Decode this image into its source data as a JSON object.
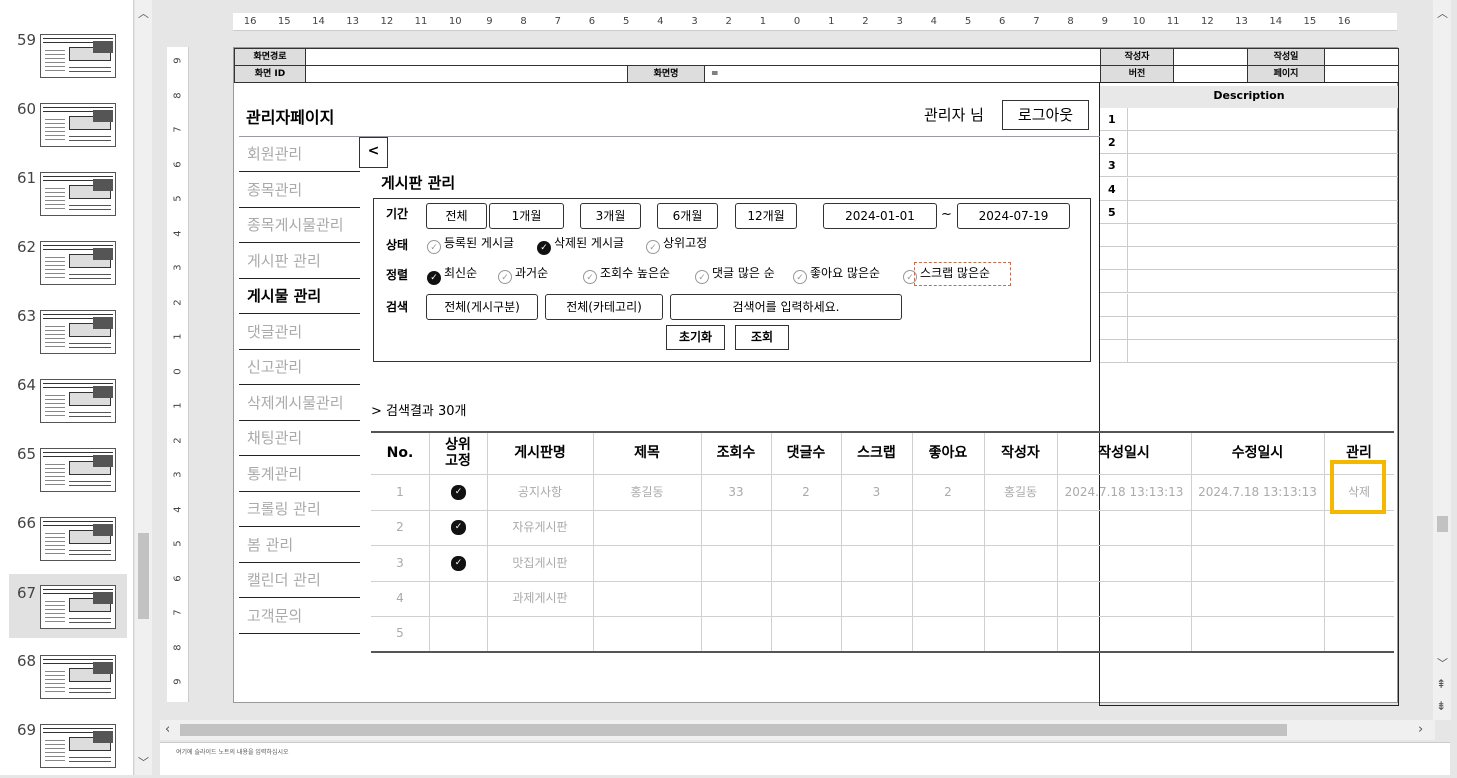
{
  "slides": [
    {
      "num": "59"
    },
    {
      "num": "60"
    },
    {
      "num": "61"
    },
    {
      "num": "62"
    },
    {
      "num": "63"
    },
    {
      "num": "64"
    },
    {
      "num": "65"
    },
    {
      "num": "66"
    },
    {
      "num": "67"
    },
    {
      "num": "68"
    },
    {
      "num": "69"
    }
  ],
  "selected_slide": "67",
  "ruler_h": [
    "16",
    "15",
    "14",
    "13",
    "12",
    "11",
    "10",
    "9",
    "8",
    "7",
    "6",
    "5",
    "4",
    "3",
    "2",
    "1",
    "0",
    "1",
    "2",
    "3",
    "4",
    "5",
    "6",
    "7",
    "8",
    "9",
    "10",
    "11",
    "12",
    "13",
    "14",
    "15",
    "16"
  ],
  "ruler_v": [
    "9",
    "8",
    "7",
    "6",
    "5",
    "4",
    "3",
    "2",
    "1",
    "0",
    "1",
    "2",
    "3",
    "4",
    "5",
    "6",
    "7",
    "8",
    "9"
  ],
  "header": {
    "path_label": "화면경로",
    "id_label": "화면 ID",
    "name_label": "화면명",
    "name_value": "=",
    "author_label": "작성자",
    "date_label": "작성일",
    "version_label": "버전",
    "page_label": "페이지",
    "description_label": "Description",
    "desc_rows": [
      "1",
      "2",
      "3",
      "4",
      "5",
      "",
      "",
      "",
      "",
      "",
      ""
    ]
  },
  "app": {
    "title": "관리자페이지",
    "user_text": "관리자 님",
    "logout": "로그아웃",
    "collapse": "<"
  },
  "sidebar": {
    "items": [
      {
        "label": "회원관리"
      },
      {
        "label": "종목관리"
      },
      {
        "label": "종목게시물관리"
      },
      {
        "label": "게시판 관리"
      },
      {
        "label": "게시물 관리"
      },
      {
        "label": "댓글관리"
      },
      {
        "label": "신고관리"
      },
      {
        "label": "삭제게시물관리"
      },
      {
        "label": "채팅관리"
      },
      {
        "label": "통계관리"
      },
      {
        "label": "크롤링 관리"
      },
      {
        "label": "봄 관리"
      },
      {
        "label": "캘린더 관리"
      },
      {
        "label": "고객문의"
      }
    ],
    "active_index": 4
  },
  "section": {
    "title": "게시판 관리"
  },
  "filter": {
    "period_label": "기간",
    "period_buttons": [
      "전체",
      "1개월",
      "3개월",
      "6개월",
      "12개월"
    ],
    "date_from": "2024-01-01",
    "tilde": "~",
    "date_to": "2024-07-19",
    "status_label": "상태",
    "status_opts": [
      {
        "label": "등록된 게시글",
        "checked": false
      },
      {
        "label": "삭제된 게시글",
        "checked": true
      },
      {
        "label": "상위고정",
        "checked": false
      }
    ],
    "sort_label": "정렬",
    "sort_opts": [
      {
        "label": "최신순",
        "checked": true
      },
      {
        "label": "과거순",
        "checked": false
      },
      {
        "label": "조회수 높은순",
        "checked": false
      },
      {
        "label": "댓글 많은 순",
        "checked": false
      },
      {
        "label": "좋아요 많은순",
        "checked": false
      },
      {
        "label": "스크랩 많은순",
        "checked": false
      }
    ],
    "search_label": "검색",
    "select_type": "전체(게시구분)",
    "select_category": "전체(카테고리)",
    "search_placeholder": "검색어를 입력하세요.",
    "reset": "초기화",
    "query": "조회"
  },
  "results": {
    "summary": "> 검색결과 30개",
    "columns": [
      "No.",
      "상위\n고정",
      "게시판명",
      "제목",
      "조회수",
      "댓글수",
      "스크랩",
      "좋아요",
      "작성자",
      "작성일시",
      "수정일시",
      "관리"
    ],
    "rows": [
      {
        "no": "1",
        "pin": true,
        "board": "공지사항",
        "title": "홍길동",
        "views": "33",
        "comments": "2",
        "scraps": "3",
        "likes": "2",
        "author": "홍길동",
        "created": "2024.7.18 13:13:13",
        "updated": "2024.7.18 13:13:13",
        "action": "삭제"
      },
      {
        "no": "2",
        "pin": true,
        "board": "자유게시판",
        "title": "",
        "views": "",
        "comments": "",
        "scraps": "",
        "likes": "",
        "author": "",
        "created": "",
        "updated": "",
        "action": ""
      },
      {
        "no": "3",
        "pin": true,
        "board": "맛집게시판",
        "title": "",
        "views": "",
        "comments": "",
        "scraps": "",
        "likes": "",
        "author": "",
        "created": "",
        "updated": "",
        "action": ""
      },
      {
        "no": "4",
        "pin": false,
        "board": "과제게시판",
        "title": "",
        "views": "",
        "comments": "",
        "scraps": "",
        "likes": "",
        "author": "",
        "created": "",
        "updated": "",
        "action": ""
      },
      {
        "no": "5",
        "pin": false,
        "board": "",
        "title": "",
        "views": "",
        "comments": "",
        "scraps": "",
        "likes": "",
        "author": "",
        "created": "",
        "updated": "",
        "action": ""
      }
    ]
  },
  "notes_text": "여기에 슬라이드 노트의 내용을 입력하십시오",
  "colors": {
    "highlight": "#f5b800"
  }
}
